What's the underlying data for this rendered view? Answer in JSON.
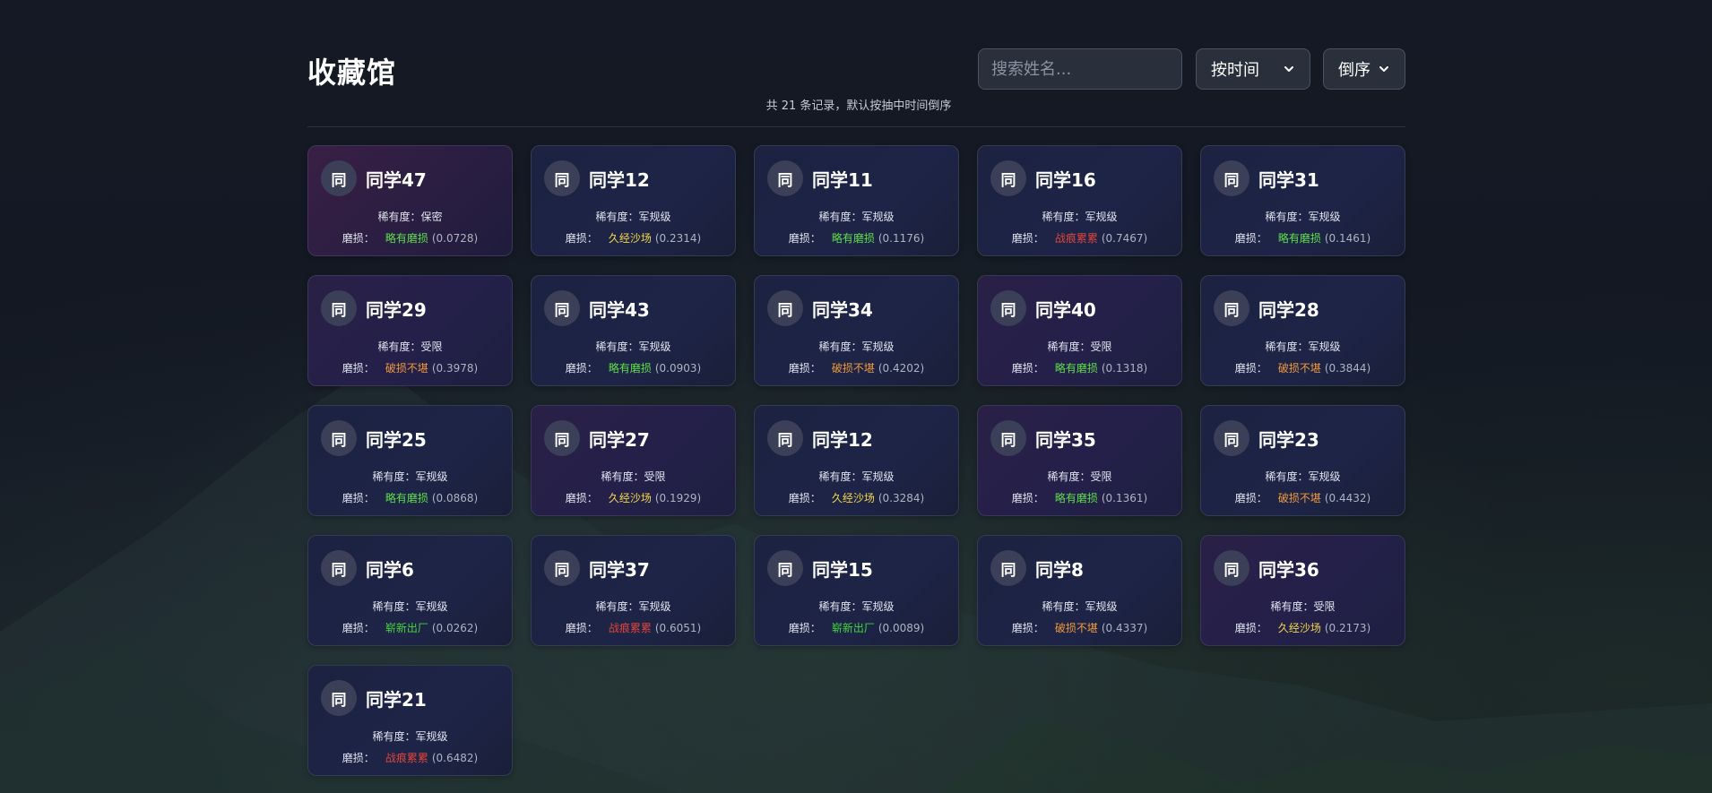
{
  "header": {
    "title": "收藏馆",
    "search_placeholder": "搜索姓名...",
    "sort_field": "按时间",
    "sort_order": "倒序",
    "subtitle": "共 21 条记录，默认按抽中时间倒序"
  },
  "labels": {
    "rarity_prefix": "稀有度：",
    "wear_prefix": "磨损："
  },
  "colors": {
    "略有磨损": "#5fe04a",
    "久经沙场": "#f2d64c",
    "战痕累累": "#e0453b",
    "破损不堪": "#f09a3a",
    "崭新出厂": "#44d63c"
  },
  "cards": [
    {
      "avatar": "同",
      "name": "同学47",
      "rarity": "保密",
      "wear": "略有磨损",
      "value": "(0.0728)"
    },
    {
      "avatar": "同",
      "name": "同学12",
      "rarity": "军规级",
      "wear": "久经沙场",
      "value": "(0.2314)"
    },
    {
      "avatar": "同",
      "name": "同学11",
      "rarity": "军规级",
      "wear": "略有磨损",
      "value": "(0.1176)"
    },
    {
      "avatar": "同",
      "name": "同学16",
      "rarity": "军规级",
      "wear": "战痕累累",
      "value": "(0.7467)"
    },
    {
      "avatar": "同",
      "name": "同学31",
      "rarity": "军规级",
      "wear": "略有磨损",
      "value": "(0.1461)"
    },
    {
      "avatar": "同",
      "name": "同学29",
      "rarity": "受限",
      "wear": "破损不堪",
      "value": "(0.3978)"
    },
    {
      "avatar": "同",
      "name": "同学43",
      "rarity": "军规级",
      "wear": "略有磨损",
      "value": "(0.0903)"
    },
    {
      "avatar": "同",
      "name": "同学34",
      "rarity": "军规级",
      "wear": "破损不堪",
      "value": "(0.4202)"
    },
    {
      "avatar": "同",
      "name": "同学40",
      "rarity": "受限",
      "wear": "略有磨损",
      "value": "(0.1318)"
    },
    {
      "avatar": "同",
      "name": "同学28",
      "rarity": "军规级",
      "wear": "破损不堪",
      "value": "(0.3844)"
    },
    {
      "avatar": "同",
      "name": "同学25",
      "rarity": "军规级",
      "wear": "略有磨损",
      "value": "(0.0868)"
    },
    {
      "avatar": "同",
      "name": "同学27",
      "rarity": "受限",
      "wear": "久经沙场",
      "value": "(0.1929)"
    },
    {
      "avatar": "同",
      "name": "同学12",
      "rarity": "军规级",
      "wear": "久经沙场",
      "value": "(0.3284)"
    },
    {
      "avatar": "同",
      "name": "同学35",
      "rarity": "受限",
      "wear": "略有磨损",
      "value": "(0.1361)"
    },
    {
      "avatar": "同",
      "name": "同学23",
      "rarity": "军规级",
      "wear": "破损不堪",
      "value": "(0.4432)"
    },
    {
      "avatar": "同",
      "name": "同学6",
      "rarity": "军规级",
      "wear": "崭新出厂",
      "value": "(0.0262)"
    },
    {
      "avatar": "同",
      "name": "同学37",
      "rarity": "军规级",
      "wear": "战痕累累",
      "value": "(0.6051)"
    },
    {
      "avatar": "同",
      "name": "同学15",
      "rarity": "军规级",
      "wear": "崭新出厂",
      "value": "(0.0089)"
    },
    {
      "avatar": "同",
      "name": "同学8",
      "rarity": "军规级",
      "wear": "破损不堪",
      "value": "(0.4337)"
    },
    {
      "avatar": "同",
      "name": "同学36",
      "rarity": "受限",
      "wear": "久经沙场",
      "value": "(0.2173)"
    },
    {
      "avatar": "同",
      "name": "同学21",
      "rarity": "军规级",
      "wear": "战痕累累",
      "value": "(0.6482)"
    }
  ]
}
